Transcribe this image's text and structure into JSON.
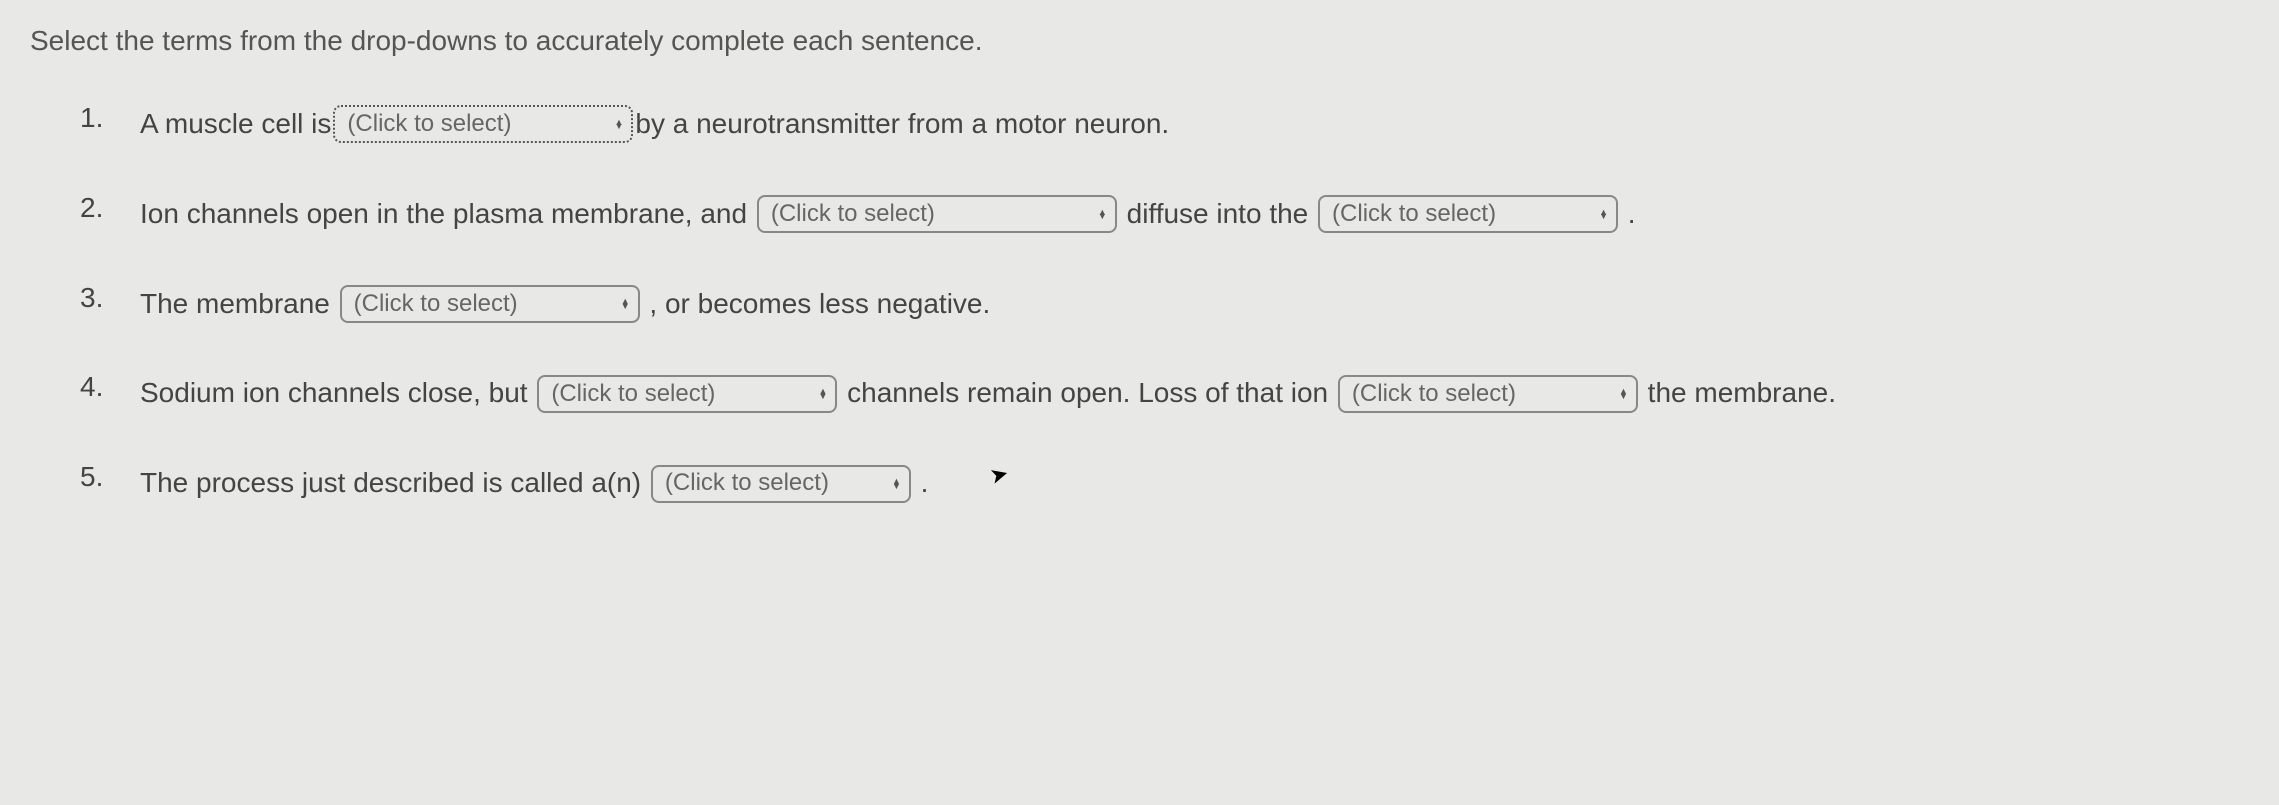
{
  "instruction": "Select the terms from the drop-downs to accurately complete each sentence.",
  "dropdown_placeholder": "(Click to select)",
  "questions": [
    {
      "number": "1.",
      "parts": [
        {
          "type": "text",
          "value": "A muscle cell is"
        },
        {
          "type": "dropdown",
          "width": "w1",
          "focused": true,
          "name": "q1-dropdown-1"
        },
        {
          "type": "text",
          "value": "by a neurotransmitter from a motor neuron."
        }
      ]
    },
    {
      "number": "2.",
      "parts": [
        {
          "type": "text",
          "value": "Ion channels open in the plasma membrane, and "
        },
        {
          "type": "dropdown",
          "width": "w2",
          "name": "q2-dropdown-1"
        },
        {
          "type": "text",
          "value": " diffuse into the "
        },
        {
          "type": "dropdown",
          "width": "w3",
          "name": "q2-dropdown-2"
        },
        {
          "type": "text",
          "value": " ."
        }
      ]
    },
    {
      "number": "3.",
      "parts": [
        {
          "type": "text",
          "value": "The membrane "
        },
        {
          "type": "dropdown",
          "width": "w4",
          "name": "q3-dropdown-1"
        },
        {
          "type": "text",
          "value": " , or becomes less negative."
        }
      ]
    },
    {
      "number": "4.",
      "parts": [
        {
          "type": "text",
          "value": "Sodium ion channels close, but "
        },
        {
          "type": "dropdown",
          "width": "w5",
          "name": "q4-dropdown-1"
        },
        {
          "type": "text",
          "value": " channels remain open. Loss of that ion "
        },
        {
          "type": "dropdown",
          "width": "w6",
          "name": "q4-dropdown-2"
        },
        {
          "type": "text",
          "value": " the membrane."
        }
      ]
    },
    {
      "number": "5.",
      "parts": [
        {
          "type": "text",
          "value": "The process just described is called a(n) "
        },
        {
          "type": "dropdown",
          "width": "w7",
          "name": "q5-dropdown-1"
        },
        {
          "type": "text",
          "value": " ."
        }
      ]
    }
  ]
}
